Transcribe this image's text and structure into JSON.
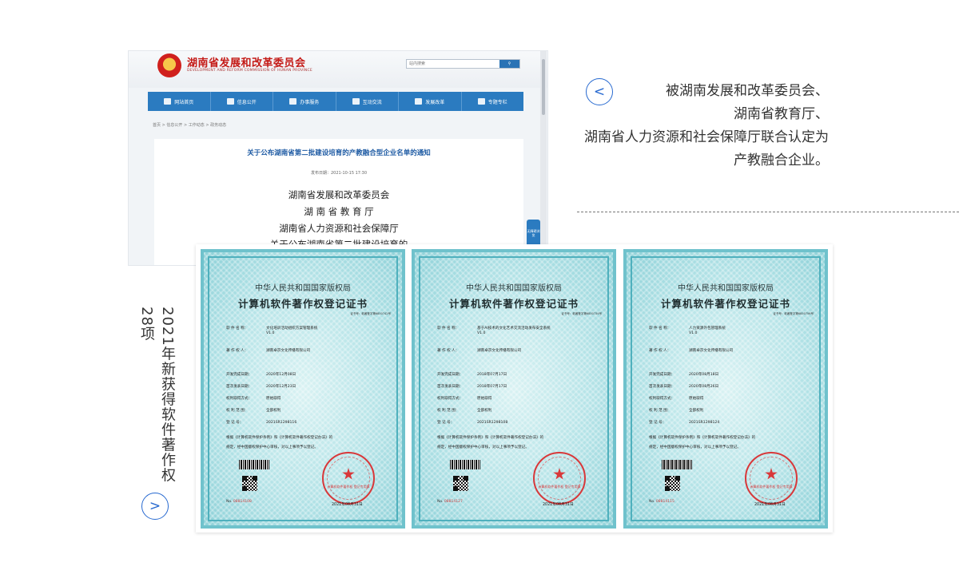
{
  "website": {
    "site_name": "湖南省发展和改革委员会",
    "site_name_en": "DEVELOPMENT AND REFORM COMMISSION OF HUNAN PROVINCE",
    "search_placeholder": "站内搜索",
    "nav": [
      "网站首页",
      "信息公开",
      "办事服务",
      "互动交流",
      "发展改革",
      "专题专栏"
    ],
    "breadcrumb": "首页 > 信息公开 > 工作动态 > 政务动态",
    "article_title": "关于公布湖南省第二批建设培育的产教融合型企业名单的通知",
    "article_date": "发布日期：2021-10-15 17:30",
    "article_lines": [
      "湖南省发展和改革委员会",
      "湖 南 省 教 育 厅",
      "湖南省人力资源和社会保障厅",
      "关于公布湖南省第二批建设培育的"
    ],
    "float_label": "无障碍浏览"
  },
  "caption": {
    "lines": [
      "被湖南发展和改革委员会、",
      "湖南省教育厅、",
      "湖南省人力资源和社会保障厅联合认定为",
      "产教融合企业。"
    ]
  },
  "vertical_caption": "2021年新获得软件著作权28项",
  "prev_icon": "chevron-left-icon",
  "next_icon": "chevron-right-icon",
  "prev_glyph": "<",
  "next_glyph": ">",
  "certificates": [
    {
      "header1": "中华人民共和国国家版权局",
      "header2": "计算机软件著作权登记证书",
      "cert_num": "证书号：软著登字第6850742号",
      "software_label": "软 件 名 称：",
      "software_name": "文化培训活动组织方案管理系统",
      "version": "V1.0",
      "owner_label": "著 作 权 人：",
      "owner": "湖南卓京文化传播有限公司",
      "dev_date_label": "开发完成日期：",
      "dev_date": "2020年12月08日",
      "pub_date_label": "首次发表日期：",
      "pub_date": "2020年12月23日",
      "method_label": "权利取得方式：",
      "method": "原始取得",
      "scope_label": "权 利 范 围：",
      "scope": "全部权利",
      "reg_label": "登 记 号：",
      "reg_no": "2021SR1298116",
      "note1": "根据《计算机软件保护条例》和《计算机软件著作权登记办法》的",
      "note2": "规定，经中国版权保护中心审核，对以上事项予以登记。",
      "no": "No.",
      "serial": "08814108",
      "date": "2021年08月31日",
      "seal_text": "计算机软件著作权 登记专用章"
    },
    {
      "header1": "中华人民共和国国家版权局",
      "header2": "计算机软件著作权登记证书",
      "cert_num": "证书号：软著登字第6850734号",
      "software_label": "软 件 名 称：",
      "software_name": "基于AI技术的文化艺术交流活动发布安全系统",
      "version": "V1.0",
      "owner_label": "著 作 权 人：",
      "owner": "湖南卓京文化传播有限公司",
      "dev_date_label": "开发完成日期：",
      "dev_date": "2018年07月17日",
      "pub_date_label": "首次发表日期：",
      "pub_date": "2018年07月17日",
      "method_label": "权利取得方式：",
      "method": "原始取得",
      "scope_label": "权 利 范 围：",
      "scope": "全部权利",
      "reg_label": "登 记 号：",
      "reg_no": "2021SR1298108",
      "note1": "根据《计算机软件保护条例》和《计算机软件著作权登记办法》的",
      "note2": "规定，经中国版权保护中心审核，对以上事项予以登记。",
      "no": "No.",
      "serial": "08814127",
      "date": "2021年08月31日",
      "seal_text": "计算机软件著作权 登记专用章"
    },
    {
      "header1": "中华人民共和国国家版权局",
      "header2": "计算机软件著作权登记证书",
      "cert_num": "证书号：软著登字第6850756号",
      "software_label": "软 件 名 称：",
      "software_name": "人力资源外包管理系统",
      "version": "V1.0",
      "owner_label": "著 作 权 人：",
      "owner": "湖南卓京文化传播有限公司",
      "dev_date_label": "开发完成日期：",
      "dev_date": "2020年08月18日",
      "pub_date_label": "首次发表日期：",
      "pub_date": "2020年08月26日",
      "method_label": "权利取得方式：",
      "method": "原始取得",
      "scope_label": "权 利 范 围：",
      "scope": "全部权利",
      "reg_label": "登 记 号：",
      "reg_no": "2021SR1298124",
      "note1": "根据《计算机软件保护条例》和《计算机软件著作权登记办法》的",
      "note2": "规定，经中国版权保护中心审核，对以上事项予以登记。",
      "no": "No.",
      "serial": "08814115",
      "date": "2021年08月31日",
      "seal_text": "计算机软件著作权 登记专用章"
    }
  ],
  "colors": {
    "accent": "#2769d0",
    "site_nav": "#2b7bc0",
    "site_title": "#c41a16",
    "seal": "#d8383a"
  }
}
